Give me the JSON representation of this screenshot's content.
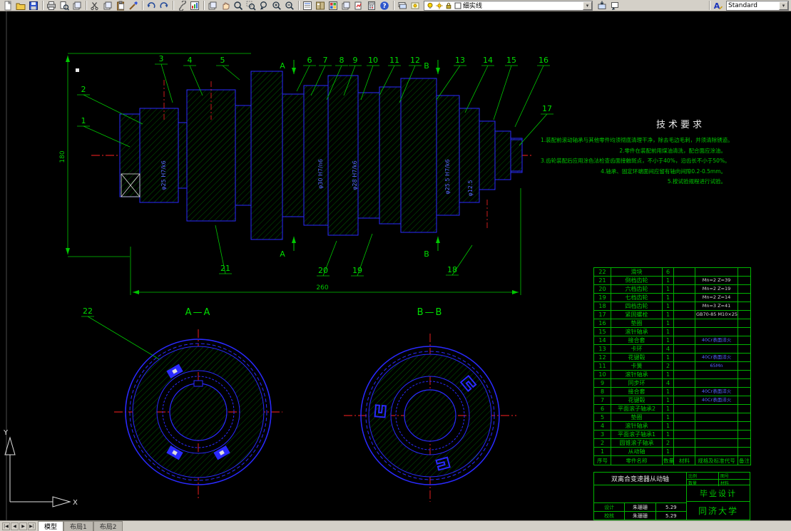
{
  "toolbar": {
    "main_icons": [
      "new-file",
      "open-file",
      "save",
      "plot",
      "plot-preview",
      "publish",
      "cut",
      "copy",
      "paste",
      "match-properties",
      "undo",
      "redo",
      "insert-hyperlink",
      "insert-ole-object",
      "named-views",
      "pan-realtime",
      "zoom-realtime",
      "zoom-window",
      "zoom-previous",
      "zoom-in",
      "zoom-out",
      "properties",
      "designcenter",
      "tool-palettes",
      "sheetset-manager",
      "markup-set-manager",
      "quickcalc",
      "help"
    ],
    "layer_icons": [
      "layer-properties-manager",
      "layer-states-manager"
    ],
    "layer_combo": {
      "icons": [
        "layer-on-bulb",
        "layer-freeze-sun",
        "layer-lock",
        "layer-color-swatch"
      ],
      "value": "细实线"
    },
    "post_layer_icons": [
      "make-objects-layer",
      "layer-previous"
    ],
    "style_icon": "text-style",
    "style_combo": {
      "value": "Standard"
    }
  },
  "tab_bar": {
    "nav_buttons": [
      "first-tab",
      "previous-tab",
      "next-tab",
      "last-tab"
    ],
    "tabs": [
      {
        "label": "模型",
        "active": true
      },
      {
        "label": "布局1",
        "active": false
      },
      {
        "label": "布局2",
        "active": false
      }
    ]
  },
  "ucs": {
    "x_label": "X",
    "y_label": "Y"
  },
  "drawing": {
    "callouts": [
      "1",
      "2",
      "3",
      "4",
      "5",
      "6",
      "7",
      "8",
      "9",
      "10",
      "11",
      "12",
      "13",
      "14",
      "15",
      "16",
      "17",
      "18",
      "19",
      "20",
      "21",
      "22"
    ],
    "section_label_a": "A—A",
    "section_label_b": "B—B",
    "arrow_label_a": "A",
    "arrow_label_b": "B",
    "dim_overall_length": "260",
    "dim_overall_height": "180",
    "shaft_dims": [
      "φ25 H7/k6",
      "φ30 H7/n6",
      "φ28 H7/k6",
      "φ25.5 H7/k6",
      "φ12.5"
    ],
    "tech_requirements": {
      "title": "技术要求",
      "lines": [
        "1.装配前滚动轴承与其他零件均须彻底清理干净，除去毛边毛刺，并须清除锈迹。",
        "2.零件在装配前用煤油清洗，配合面应涂油。",
        "3.齿轮装配后应用涂色法检查齿面接触斑点，不小于40%，沿齿长不小于50%。",
        "4.轴承、固定环端面间应留有轴向间隙0.2-0.5mm。",
        "5.按试验规程进行试验。"
      ]
    }
  },
  "parts_table": {
    "headers": [
      "序号",
      "零件名称",
      "数量",
      "材料",
      "规格及标准代号",
      "备注"
    ],
    "rows": [
      {
        "no": "22",
        "name": "滑块",
        "qty": "6",
        "mat": "",
        "spec": "",
        "note": "",
        "blue": false
      },
      {
        "no": "21",
        "name": "倒档齿轮",
        "qty": "1",
        "mat": "",
        "spec": "Mn=2 Z=39",
        "note": "",
        "blue": false
      },
      {
        "no": "20",
        "name": "六档齿轮",
        "qty": "1",
        "mat": "",
        "spec": "Mn=2 Z=19",
        "note": "",
        "blue": false
      },
      {
        "no": "19",
        "name": "七档齿轮",
        "qty": "1",
        "mat": "",
        "spec": "Mn=2 Z=14",
        "note": "",
        "blue": false
      },
      {
        "no": "18",
        "name": "四档齿轮",
        "qty": "1",
        "mat": "",
        "spec": "Mn=3 Z=41",
        "note": "",
        "blue": false
      },
      {
        "no": "17",
        "name": "紧固螺栓",
        "qty": "1",
        "mat": "",
        "spec": "GB70-85 M10×25",
        "note": "",
        "blue": false
      },
      {
        "no": "16",
        "name": "垫圈",
        "qty": "1",
        "mat": "",
        "spec": "",
        "note": "",
        "blue": false
      },
      {
        "no": "15",
        "name": "滚针轴承",
        "qty": "1",
        "mat": "",
        "spec": "",
        "note": "",
        "blue": false
      },
      {
        "no": "14",
        "name": "接合套",
        "qty": "1",
        "mat": "",
        "spec": "40Cr表面淬火",
        "note": "",
        "blue": true
      },
      {
        "no": "13",
        "name": "卡环",
        "qty": "4",
        "mat": "",
        "spec": "",
        "note": "",
        "blue": false
      },
      {
        "no": "12",
        "name": "花键毂",
        "qty": "1",
        "mat": "",
        "spec": "40Cr表面淬火",
        "note": "",
        "blue": true
      },
      {
        "no": "11",
        "name": "卡簧",
        "qty": "2",
        "mat": "",
        "spec": "65Mn",
        "note": "",
        "blue": true
      },
      {
        "no": "10",
        "name": "滚针轴承",
        "qty": "1",
        "mat": "",
        "spec": "",
        "note": "",
        "blue": false
      },
      {
        "no": "9",
        "name": "同步环",
        "qty": "4",
        "mat": "",
        "spec": "",
        "note": "",
        "blue": false
      },
      {
        "no": "8",
        "name": "接合套",
        "qty": "1",
        "mat": "",
        "spec": "40Cr表面淬火",
        "note": "",
        "blue": true
      },
      {
        "no": "7",
        "name": "花键毂",
        "qty": "1",
        "mat": "",
        "spec": "40Cr表面淬火",
        "note": "",
        "blue": true
      },
      {
        "no": "6",
        "name": "平面滚子轴承2",
        "qty": "1",
        "mat": "",
        "spec": "",
        "note": "",
        "blue": false
      },
      {
        "no": "5",
        "name": "垫圈",
        "qty": "1",
        "mat": "",
        "spec": "",
        "note": "",
        "blue": false
      },
      {
        "no": "4",
        "name": "滚针轴承",
        "qty": "1",
        "mat": "",
        "spec": "",
        "note": "",
        "blue": false
      },
      {
        "no": "3",
        "name": "平面滚子轴承1",
        "qty": "1",
        "mat": "",
        "spec": "",
        "note": "",
        "blue": false
      },
      {
        "no": "2",
        "name": "圆锥滚子轴承",
        "qty": "2",
        "mat": "",
        "spec": "",
        "note": "",
        "blue": false
      },
      {
        "no": "1",
        "name": "从动轴",
        "qty": "1",
        "mat": "",
        "spec": "",
        "note": "",
        "blue": false
      }
    ]
  },
  "title_block": {
    "part_name": "双离合变速器从动轴",
    "field_scale_label": "比例",
    "field_drawno_label": "图号",
    "field_qty_label": "数量",
    "field_material_label": "材料",
    "sign_rows": [
      {
        "role": "设计",
        "name": "朱珊珊",
        "date": "5.29"
      },
      {
        "role": "校核",
        "name": "朱珊珊",
        "date": "5.29"
      }
    ],
    "project": "毕业设计",
    "organization": "同济大学"
  },
  "colors": {
    "outline_blue": "#2a2aff",
    "annotation_green": "#00c800",
    "centerline_red": "#ff2222",
    "text_white": "#e0e0e0"
  }
}
